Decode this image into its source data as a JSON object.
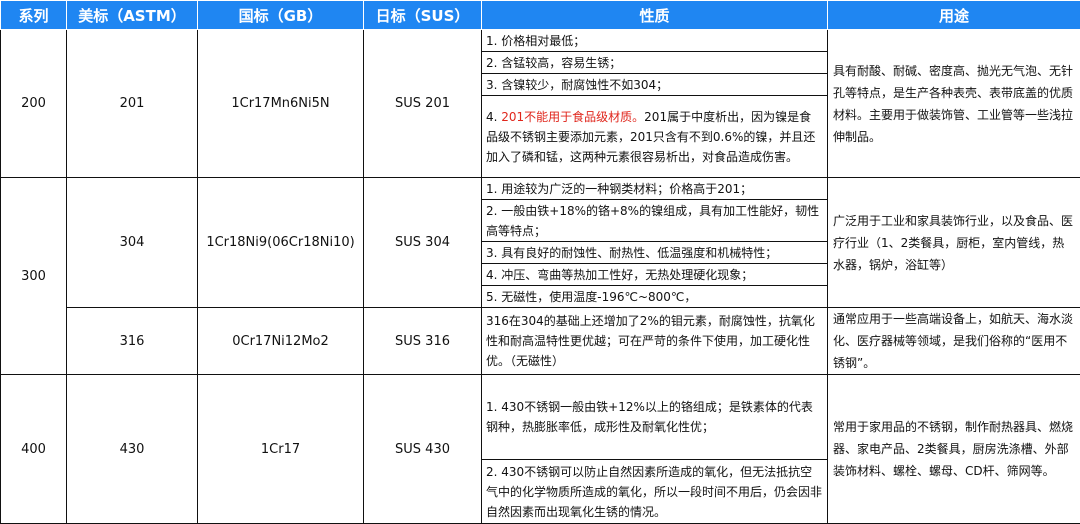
{
  "headers": [
    "系列",
    "美标（ASTM）",
    "国标（GB）",
    "日标（SUS）",
    "性质",
    "用途"
  ],
  "rows": {
    "r200": {
      "series": "200",
      "astm": "201",
      "gb": "1Cr17Mn6Ni5N",
      "sus": "SUS 201",
      "props": [
        "1. 价格相对最低；",
        "2. 含锰较高，容易生锈；",
        "3. 含镍较少，耐腐蚀性不如304；"
      ],
      "prop4_prefix": "4. ",
      "prop4_red": "201不能用于食品级材质。",
      "prop4_rest": "201属于中度析出，因为镍是食品级不锈钢主要添加元素，201只含有不到0.6%的镍，并且还加入了磷和锰，这两种元素很容易析出，对食品造成伤害。",
      "use": "具有耐酸、耐碱、密度高、抛光无气泡、无针孔等特点，是生产各种表壳、表带底盖的优质材料。主要用于做装饰管、工业管等一些浅拉伸制品。"
    },
    "r300": {
      "series": "300",
      "g304": {
        "astm": "304",
        "gb": "1Cr18Ni9(06Cr18Ni10)",
        "sus": "SUS 304",
        "props": [
          "1. 用途较为广泛的一种钢类材料；价格高于201；",
          "2. 一般由铁+18%的铬+8%的镍组成，具有加工性能好，韧性高等特点；",
          "3. 具有良好的耐蚀性、耐热性、低温强度和机械特性；",
          "4. 冲压、弯曲等热加工性好，无热处理硬化现象；",
          "5. 无磁性，使用温度-196℃~800℃，"
        ],
        "use": "广泛用于工业和家具装饰行业，以及食品、医疗行业（1、2类餐具，厨柜，室内管线，热水器，锅炉，浴缸等）"
      },
      "g316": {
        "astm": "316",
        "gb": "0Cr17Ni12Mo2",
        "sus": "SUS 316",
        "prop": "316在304的基础上还增加了2%的钼元素，耐腐蚀性，抗氧化性和耐高温特性更优越；可在严苛的条件下使用，加工硬化性优。（无磁性）",
        "use": "通常应用于一些高端设备上，如航天、海水淡化、医疗器械等领域，是我们俗称的“医用不锈钢”。"
      }
    },
    "r400": {
      "series": "400",
      "astm": "430",
      "gb": "1Cr17",
      "sus": "SUS 430",
      "props": [
        "1. 430不锈钢一般由铁+12%以上的铬组成；是铁素体的代表钢种，热膨胀率低，成形性及耐氧化性优；",
        "2. 430不锈钢可以防止自然因素所造成的氧化，但无法抵抗空气中的化学物质所造成的氧化，所以一段时间不用后，仍会因非自然因素而出现氧化生锈的情况。"
      ],
      "use": "常用于家用品的不锈钢，制作耐热器具、燃烧器、家电产品、2类餐具，厨房洗涤槽、外部装饰材料、螺栓、螺母、CD杆、筛网等。"
    }
  }
}
